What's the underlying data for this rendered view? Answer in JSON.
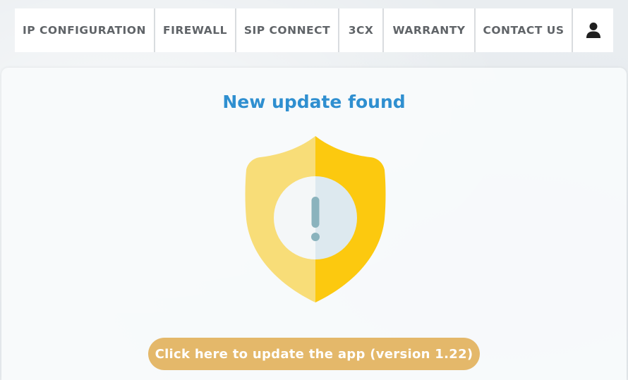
{
  "nav": {
    "items": [
      {
        "label": "IP CONFIGURATION"
      },
      {
        "label": "FIREWALL"
      },
      {
        "label": "SIP CONNECT"
      },
      {
        "label": "3CX"
      },
      {
        "label": "WARRANTY"
      },
      {
        "label": "CONTACT US"
      }
    ],
    "user_icon": "user-icon"
  },
  "main": {
    "title": "New update found",
    "illustration_icon": "shield-warning-icon",
    "update_button_label": "Click here to update the app (version 1.22)"
  },
  "colors": {
    "title": "#2f8fd0",
    "button": "#e4b86a",
    "shield_light": "#f8dd78",
    "shield_dark": "#fcc90f",
    "nav_text": "#606468"
  }
}
